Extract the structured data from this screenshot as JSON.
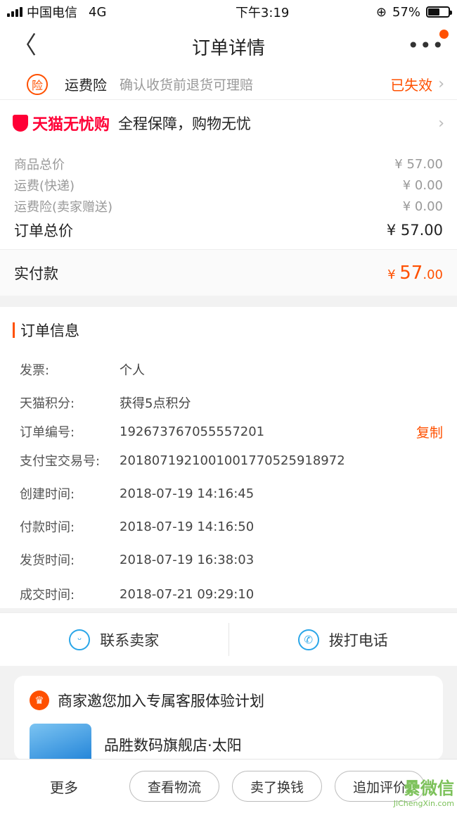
{
  "status_bar": {
    "carrier": "中国电信",
    "network": "4G",
    "time": "下午3:19",
    "battery_text": "57%",
    "battery_level": 0.57
  },
  "nav": {
    "back_glyph": "〈",
    "title": "订单详情",
    "more_glyph": "•••"
  },
  "insurance": {
    "badge": "险",
    "name": "运费险",
    "desc": "确认收货前退货可理赔",
    "status": "已失效"
  },
  "tmall": {
    "logo": "天猫无忧购",
    "slogan": "全程保障，购物无忧"
  },
  "prices": {
    "rows": [
      {
        "label": "商品总价",
        "value": "¥ 57.00"
      },
      {
        "label": "运费(快递)",
        "value": "¥ 0.00"
      },
      {
        "label": "运费险(卖家赠送)",
        "value": "¥ 0.00"
      }
    ],
    "total_label": "订单总价",
    "total_value": "¥ 57.00",
    "paid_label": "实付款",
    "paid_symbol": "¥ ",
    "paid_int": "57",
    "paid_dec": ".00"
  },
  "order_info": {
    "title": "订单信息",
    "rows": [
      {
        "k": "发票:",
        "v": "个人"
      },
      {
        "k": "天猫积分:",
        "v": "获得5点积分"
      },
      {
        "k": "订单编号:",
        "v": "192673767055557201",
        "action": "复制"
      },
      {
        "k": "支付宝交易号:",
        "v": "2018071921001001770525918972"
      },
      {
        "k": "创建时间:",
        "v": "2018-07-19 14:16:45"
      },
      {
        "k": "付款时间:",
        "v": "2018-07-19 14:16:50"
      },
      {
        "k": "发货时间:",
        "v": "2018-07-19 16:38:03"
      },
      {
        "k": "成交时间:",
        "v": "2018-07-21 09:29:10"
      }
    ]
  },
  "contact": {
    "seller": "联系卖家",
    "call": "拨打电话"
  },
  "invite": {
    "title": "商家邀您加入专属客服体验计划",
    "crown": "♛",
    "shop_name": "品胜数码旗舰店·太阳"
  },
  "bottom": {
    "more": "更多",
    "btn1": "查看物流",
    "btn2": "卖了换钱",
    "btn3": "追加评价"
  },
  "watermark": {
    "main": "纍微信",
    "sub": "JiChengXin.com"
  }
}
